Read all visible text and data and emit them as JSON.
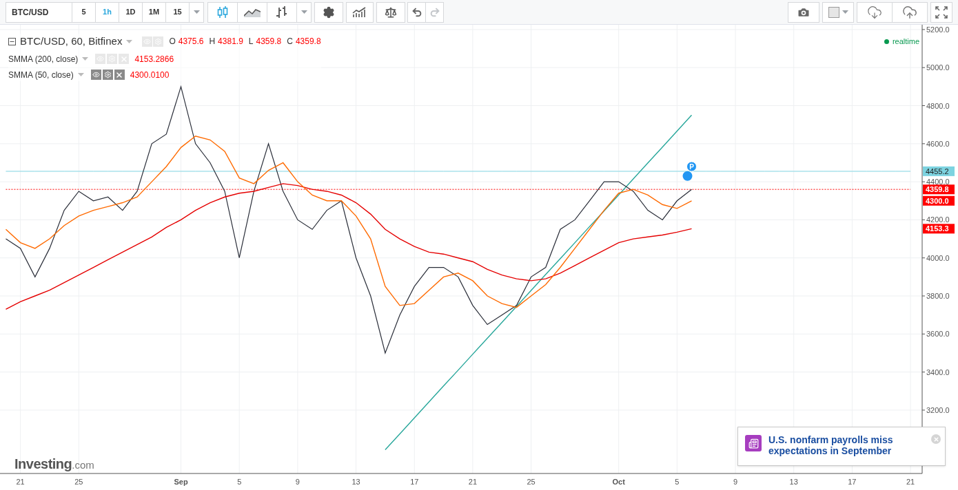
{
  "toolbar": {
    "symbol": "BTC/USD",
    "intervals": [
      {
        "label": "5",
        "selected": false
      },
      {
        "label": "1h",
        "selected": true
      },
      {
        "label": "1D",
        "selected": false
      },
      {
        "label": "1M",
        "selected": false
      },
      {
        "label": "15",
        "selected": false
      }
    ],
    "chart_types": [
      {
        "kind": "candles",
        "selected": true
      },
      {
        "kind": "area",
        "selected": false
      },
      {
        "kind": "bars",
        "selected": false
      }
    ],
    "history": [
      {
        "kind": "undo",
        "disabled": false
      },
      {
        "kind": "redo",
        "disabled": true
      }
    ]
  },
  "legend": {
    "ohlc": [
      {
        "key": "O",
        "value": "4375.6"
      },
      {
        "key": "H",
        "value": "4381.9"
      },
      {
        "key": "L",
        "value": "4359.8"
      },
      {
        "key": "C",
        "value": "4359.8"
      }
    ],
    "indicators": [
      {
        "value": "4153.2866",
        "highlighted": false
      },
      {
        "value": "4300.0100",
        "highlighted": true
      }
    ]
  },
  "status": "realtime",
  "chart": {
    "event_marker": "P",
    "price_tags": [
      {
        "label": "4455.2",
        "color": "#7dd3e0"
      },
      {
        "label": "4359.8",
        "color": "#ff0000"
      },
      {
        "label": "4300.0",
        "color": "#ff0000"
      },
      {
        "label": "4153.3",
        "color": "#ff0000"
      }
    ],
    "chart_data": {
      "type": "line",
      "grid": true,
      "categories": [
        null,
        "21",
        null,
        null,
        null,
        "25",
        null,
        null,
        null,
        null,
        null,
        null,
        "Sep",
        null,
        null,
        null,
        "5",
        null,
        null,
        null,
        "9",
        null,
        null,
        null,
        "13",
        null,
        null,
        null,
        "17",
        null,
        null,
        null,
        "21",
        null,
        null,
        null,
        "25",
        null,
        null,
        null,
        null,
        null,
        "Oct",
        null,
        null,
        null,
        "5",
        null,
        null,
        null,
        "9",
        null,
        null,
        null,
        "13",
        null,
        null,
        null,
        "17",
        null,
        null,
        null,
        "21"
      ],
      "series": [
        {
          "line_style": "solid",
          "color": "#7dd3e0",
          "values": [
            4455,
            4455,
            4455,
            4455,
            4455,
            4455,
            4455,
            4455,
            4455,
            4455,
            4455,
            4455,
            4455,
            4455,
            4455,
            4455,
            4455,
            4455,
            4455,
            4455,
            4455,
            4455,
            4455,
            4455,
            4455,
            4455,
            4455,
            4455,
            4455,
            4455,
            4455,
            4455,
            4455,
            4455,
            4455,
            4455,
            4455,
            4455,
            4455,
            4455,
            4455,
            4455,
            4455,
            4455,
            4455,
            4455,
            4455,
            4455,
            4455,
            4455,
            4455,
            4455,
            4455,
            4455,
            4455,
            4455,
            4455,
            4455,
            4455,
            4455,
            4455,
            4455,
            4455
          ]
        },
        {
          "line_style": "dashed",
          "color": "#ff0000",
          "values": [
            4360,
            4360,
            4360,
            4360,
            4360,
            4360,
            4360,
            4360,
            4360,
            4360,
            4360,
            4360,
            4360,
            4360,
            4360,
            4360,
            4360,
            4360,
            4360,
            4360,
            4360,
            4360,
            4360,
            4360,
            4360,
            4360,
            4360,
            4360,
            4360,
            4360,
            4360,
            4360,
            4360,
            4360,
            4360,
            4360,
            4360,
            4360,
            4360,
            4360,
            4360,
            4360,
            4360,
            4360,
            4360,
            4360,
            4360,
            4360,
            4360,
            4360,
            4360,
            4360,
            4360,
            4360,
            4360,
            4360,
            4360,
            4360,
            4360,
            4360,
            4360,
            4360,
            4360
          ]
        },
        {
          "line_style": "solid",
          "color": "#26a69a",
          "values": [
            null,
            null,
            null,
            null,
            null,
            null,
            null,
            null,
            null,
            null,
            null,
            null,
            null,
            null,
            null,
            null,
            null,
            null,
            null,
            null,
            null,
            null,
            null,
            null,
            null,
            null,
            2992,
            3075,
            3159,
            3243,
            3327,
            3410,
            3494,
            3578,
            3661,
            3745,
            3829,
            3913,
            3996,
            4080,
            4164,
            4247,
            4331,
            4415,
            4499,
            4582,
            4666,
            4750,
            null,
            null,
            null,
            null,
            null,
            null,
            null,
            null,
            null,
            null,
            null,
            null,
            null,
            null,
            null
          ]
        },
        {
          "line_style": "solid",
          "name": "BTC/USD, 60, Bitfinex",
          "color": "#2a2e39",
          "values": [
            4100,
            4050,
            3900,
            4050,
            4250,
            4350,
            4300,
            4320,
            4250,
            4350,
            4600,
            4650,
            4900,
            4600,
            4500,
            4350,
            4000,
            4350,
            4600,
            4350,
            4200,
            4150,
            4250,
            4300,
            4000,
            3800,
            3500,
            3700,
            3850,
            3950,
            3950,
            3900,
            3750,
            3650,
            3700,
            3750,
            3900,
            3950,
            4150,
            4200,
            4300,
            4400,
            4400,
            4350,
            4250,
            4200,
            4300,
            4360,
            null,
            null,
            null,
            null,
            null,
            null,
            null,
            null,
            null,
            null,
            null,
            null,
            null,
            null,
            null
          ]
        },
        {
          "line_style": "solid",
          "name": "SMMA (200, close)",
          "color": "#e50000",
          "values": [
            3730,
            3770,
            3800,
            3830,
            3870,
            3910,
            3950,
            3990,
            4030,
            4070,
            4110,
            4160,
            4200,
            4250,
            4290,
            4320,
            4340,
            4350,
            4370,
            4390,
            4380,
            4360,
            4350,
            4330,
            4290,
            4230,
            4150,
            4100,
            4060,
            4030,
            4020,
            4000,
            3980,
            3940,
            3910,
            3890,
            3880,
            3890,
            3920,
            3960,
            4000,
            4040,
            4080,
            4100,
            4110,
            4120,
            4135,
            4153,
            null,
            null,
            null,
            null,
            null,
            null,
            null,
            null,
            null,
            null,
            null,
            null,
            null,
            null,
            null
          ]
        },
        {
          "line_style": "solid",
          "name": "SMMA (50, close)",
          "color": "#ff6a00",
          "values": [
            4150,
            4080,
            4050,
            4100,
            4170,
            4220,
            4250,
            4270,
            4290,
            4320,
            4400,
            4480,
            4580,
            4640,
            4620,
            4560,
            4420,
            4390,
            4460,
            4500,
            4400,
            4330,
            4300,
            4300,
            4220,
            4100,
            3850,
            3750,
            3760,
            3830,
            3900,
            3920,
            3880,
            3800,
            3760,
            3740,
            3800,
            3860,
            3950,
            4050,
            4150,
            4250,
            4340,
            4360,
            4330,
            4280,
            4260,
            4300,
            null,
            null,
            null,
            null,
            null,
            null,
            null,
            null,
            null,
            null,
            null,
            null,
            null,
            null,
            null
          ]
        }
      ],
      "ylim": [
        2867,
        5225
      ],
      "yticks": [
        {
          "value": 3200,
          "label": "3200.0"
        },
        {
          "value": 3400,
          "label": "3400.0"
        },
        {
          "value": 3600,
          "label": "3600.0"
        },
        {
          "value": 3800,
          "label": "3800.0"
        },
        {
          "value": 4000,
          "label": "4000.0"
        },
        {
          "value": 4200,
          "label": "4200.0"
        },
        {
          "value": 4400,
          "label": "4400.0"
        },
        {
          "value": 4600,
          "label": "4600.0"
        },
        {
          "value": 4800,
          "label": "4800.0"
        },
        {
          "value": 5000,
          "label": "5000.0"
        },
        {
          "value": 5200,
          "label": "5200.0"
        }
      ]
    }
  },
  "logo": {
    "name": "Investing",
    "suffix": ".com"
  },
  "news": {
    "headline": "U.S. nonfarm payrolls miss expectations in September"
  }
}
